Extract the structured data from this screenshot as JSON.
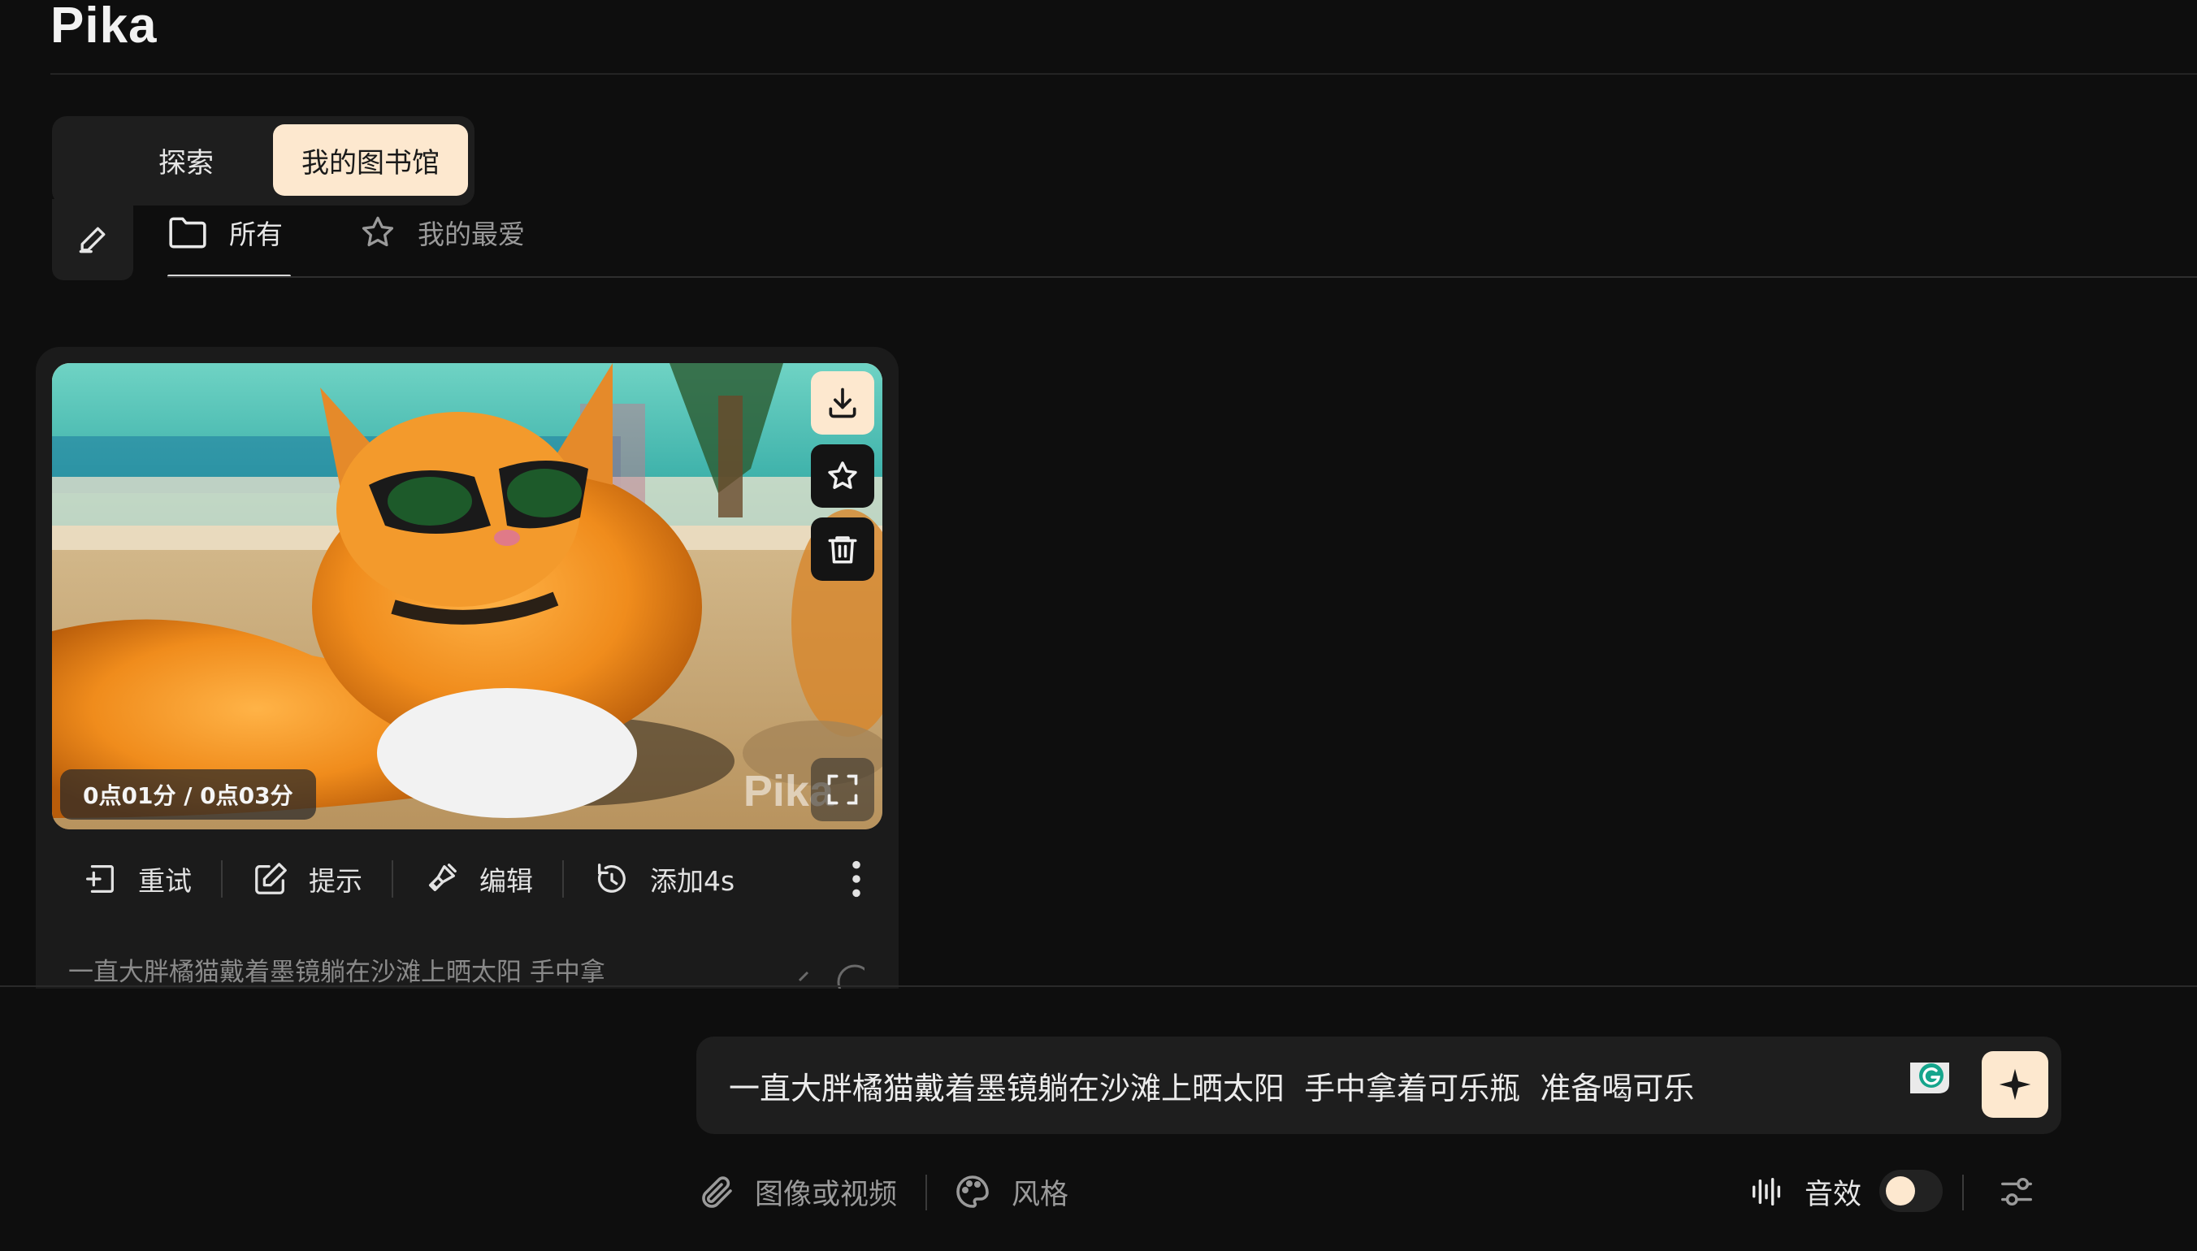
{
  "app": {
    "logo": "Pika"
  },
  "mode_tabs": {
    "explore": "探索",
    "library": "我的图书馆"
  },
  "filters": {
    "all": "所有",
    "favorites": "我的最爱"
  },
  "video_card": {
    "timecode": "0点01分 / 0点03分",
    "watermark": "Pika",
    "actions": {
      "retry": "重试",
      "prompt": "提示",
      "edit": "编辑",
      "add_time": "添加4s"
    },
    "prompt_preview": "一直大胖橘猫戴着墨镜躺在沙滩上晒太阳 手中拿"
  },
  "prompt_input": {
    "value": "一直大胖橘猫戴着墨镜躺在沙滩上晒太阳  手中拿着可乐瓶  准备喝可乐"
  },
  "bottom_bar": {
    "attach_label": "图像或视频",
    "style_label": "风格",
    "sound_label": "音效",
    "sound_enabled": false
  },
  "colors": {
    "background": "#0e0e0e",
    "accent": "#fde8cf",
    "panel": "#1e1e1e"
  }
}
